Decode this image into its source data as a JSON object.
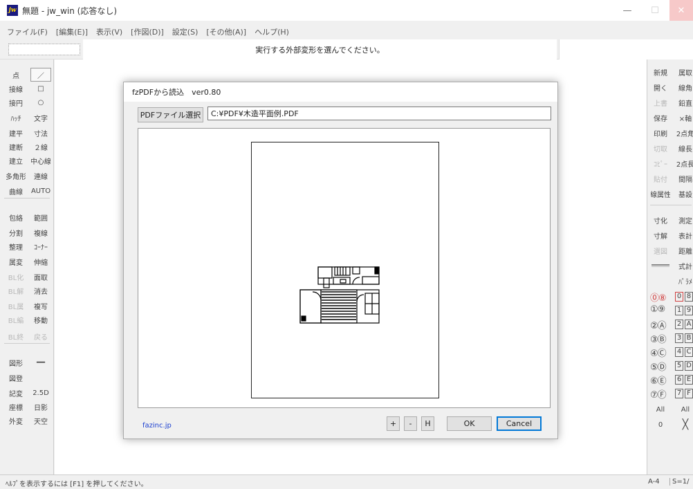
{
  "window": {
    "app_icon_text": "jw",
    "title": "無題 - jw_win (応答なし)",
    "min_glyph": "—",
    "max_glyph": "☐",
    "close_glyph": "✕"
  },
  "menu": [
    "ファイル(F)",
    "[編集(E)]",
    "表示(V)",
    "[作図(D)]",
    "設定(S)",
    "[その他(A)]",
    "ヘルプ(H)"
  ],
  "command_message": "実行する外部変形を選んでください。",
  "left_tools": [
    {
      "label": "点",
      "disabled": false
    },
    {
      "label": "／",
      "disabled": false,
      "boxed": true
    },
    {
      "label": "接線",
      "disabled": false
    },
    {
      "label": "□",
      "disabled": false
    },
    {
      "label": "接円",
      "disabled": false
    },
    {
      "label": "○",
      "disabled": false
    },
    {
      "label": "ﾊｯﾁ",
      "disabled": false
    },
    {
      "label": "文字",
      "disabled": false
    },
    {
      "label": "建平",
      "disabled": false
    },
    {
      "label": "寸法",
      "disabled": false
    },
    {
      "label": "建断",
      "disabled": false
    },
    {
      "label": "２線",
      "disabled": false
    },
    {
      "label": "建立",
      "disabled": false
    },
    {
      "label": "中心線",
      "disabled": false
    },
    {
      "label": "多角形",
      "disabled": false
    },
    {
      "label": "連線",
      "disabled": false
    },
    {
      "label": "曲線",
      "disabled": false
    },
    {
      "label": "AUTO",
      "disabled": false
    },
    {
      "label": "包絡",
      "disabled": false
    },
    {
      "label": "範囲",
      "disabled": false
    },
    {
      "label": "分割",
      "disabled": false
    },
    {
      "label": "複線",
      "disabled": false
    },
    {
      "label": "整理",
      "disabled": false
    },
    {
      "label": "ｺｰﾅｰ",
      "disabled": false
    },
    {
      "label": "属変",
      "disabled": false
    },
    {
      "label": "伸縮",
      "disabled": false
    },
    {
      "label": "BL化",
      "disabled": true
    },
    {
      "label": "面取",
      "disabled": false
    },
    {
      "label": "BL解",
      "disabled": true
    },
    {
      "label": "消去",
      "disabled": false
    },
    {
      "label": "BL属",
      "disabled": true
    },
    {
      "label": "複写",
      "disabled": false
    },
    {
      "label": "BL編",
      "disabled": true
    },
    {
      "label": "移動",
      "disabled": false
    },
    {
      "label": "BL終",
      "disabled": true
    },
    {
      "label": "戻る",
      "disabled": true
    },
    {
      "label": "図形",
      "disabled": false
    },
    {
      "label": "━━",
      "disabled": false
    },
    {
      "label": "図登",
      "disabled": false
    },
    {
      "label": "",
      "disabled": false
    },
    {
      "label": "記変",
      "disabled": false
    },
    {
      "label": "2.5D",
      "disabled": false
    },
    {
      "label": "座標",
      "disabled": false
    },
    {
      "label": "日影",
      "disabled": false
    },
    {
      "label": "外変",
      "disabled": false
    },
    {
      "label": "天空",
      "disabled": false
    }
  ],
  "right_tools": [
    {
      "label": "新規",
      "disabled": false
    },
    {
      "label": "属取",
      "disabled": false
    },
    {
      "label": "開く",
      "disabled": false
    },
    {
      "label": "線角",
      "disabled": false
    },
    {
      "label": "上書",
      "disabled": true
    },
    {
      "label": "鉛直",
      "disabled": false
    },
    {
      "label": "保存",
      "disabled": false
    },
    {
      "label": "×軸",
      "disabled": false
    },
    {
      "label": "印刷",
      "disabled": false
    },
    {
      "label": "2点角",
      "disabled": false
    },
    {
      "label": "切取",
      "disabled": true
    },
    {
      "label": "線長",
      "disabled": false
    },
    {
      "label": "ｺﾋﾟｰ",
      "disabled": true
    },
    {
      "label": "2点長",
      "disabled": false
    },
    {
      "label": "貼付",
      "disabled": true
    },
    {
      "label": "間隔",
      "disabled": false
    },
    {
      "label": "線属性",
      "disabled": false
    },
    {
      "label": "基設",
      "disabled": false
    },
    {
      "label": "寸化",
      "disabled": false
    },
    {
      "label": "測定",
      "disabled": false
    },
    {
      "label": "寸解",
      "disabled": false
    },
    {
      "label": "表計",
      "disabled": false
    },
    {
      "label": "選図",
      "disabled": true
    },
    {
      "label": "距離",
      "disabled": false
    },
    {
      "label": "",
      "disabled": false
    },
    {
      "label": "式計",
      "disabled": false
    },
    {
      "label": "",
      "disabled": false
    },
    {
      "label": "ﾊﾟﾗﾒ",
      "disabled": false
    }
  ],
  "layer_circled": [
    "⓪",
    "⑧",
    "①",
    "⑨",
    "②",
    "Ⓐ",
    "③",
    "Ⓑ",
    "④",
    "Ⓒ",
    "⑤",
    "Ⓓ",
    "⑥",
    "Ⓔ",
    "⑦",
    "Ⓕ"
  ],
  "layer_boxed": [
    "0",
    "8",
    "1",
    "9",
    "2",
    "A",
    "3",
    "B",
    "4",
    "C",
    "5",
    "D",
    "6",
    "E",
    "7",
    "F"
  ],
  "layer_all": "All",
  "layer_zero": "0",
  "layer_x": "╳",
  "dialog": {
    "title": "fzPDFから読込　ver0.80",
    "pdf_button": "PDFファイル選択",
    "path_value": "C:¥PDF¥木造平面例.PDF",
    "link": "fazinc.jp",
    "plus": "+",
    "minus": "-",
    "h": "H",
    "ok": "OK",
    "cancel": "Cancel"
  },
  "status": {
    "help": "ﾍﾙﾌﾟを表示するには [F1] を押してください。",
    "paper": "A-4",
    "scale": "S=1/"
  }
}
